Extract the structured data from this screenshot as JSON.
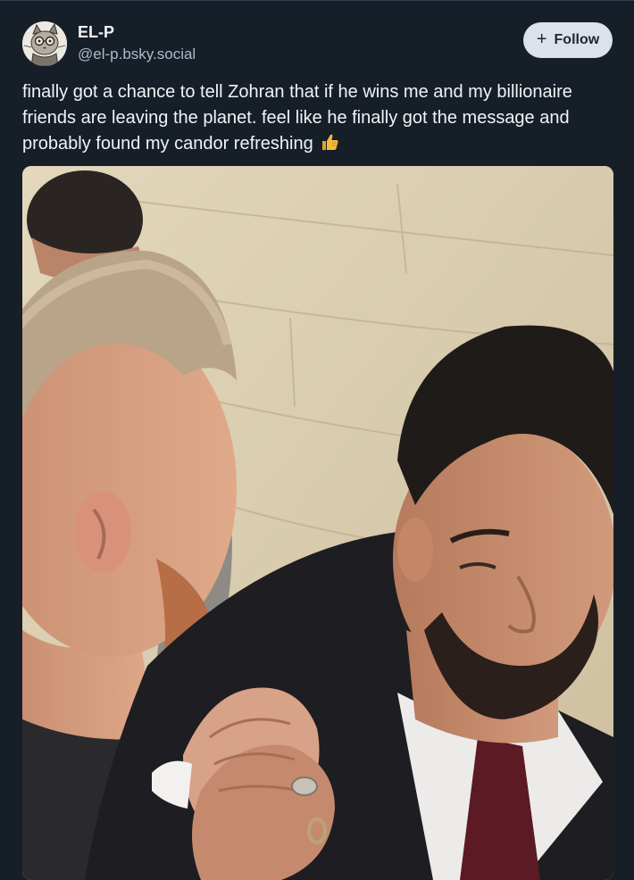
{
  "post": {
    "author": {
      "display_name": "EL-P",
      "handle": "@el-p.bsky.social",
      "avatar_icon": "cat-avatar-icon"
    },
    "follow_button": {
      "icon": "plus-icon",
      "plus_glyph": "+",
      "label": "Follow"
    },
    "text": "finally got a chance to tell Zohran that if he wins me and my billionaire friends are leaving the planet.  feel like he finally got the message and probably found my candor refreshing",
    "text_emoji": "thumbs-up-icon",
    "image": {
      "icon": "photo-icon"
    }
  },
  "colors": {
    "background": "#161e27",
    "text_primary": "#f1f3f5",
    "text_secondary": "#aebbc9",
    "follow_button_bg": "#dce2ea",
    "follow_button_text": "#1b2734",
    "thumbs_up": "#f6b93b"
  }
}
